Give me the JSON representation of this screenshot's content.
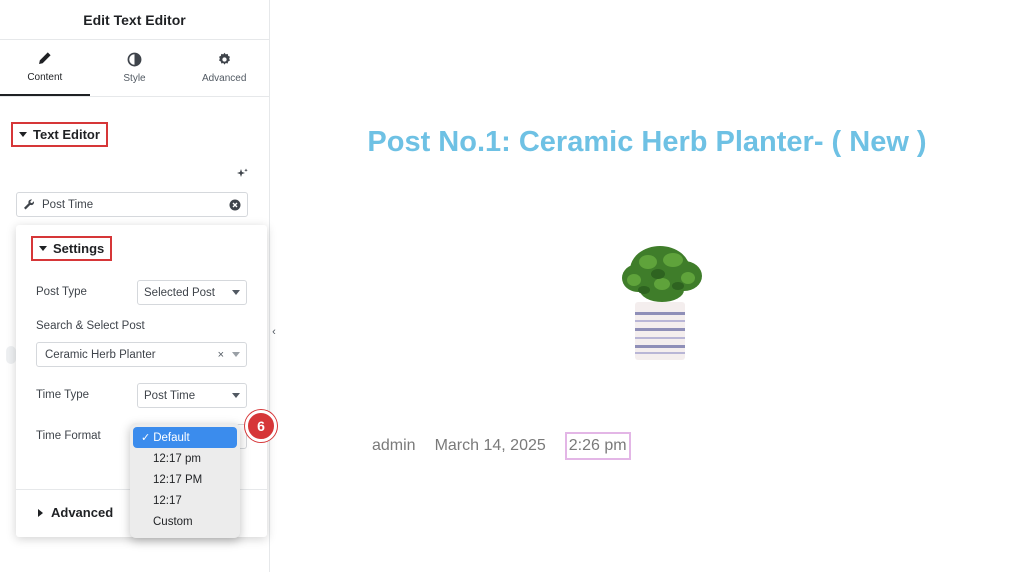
{
  "panel": {
    "title": "Edit Text Editor",
    "tabs": [
      {
        "label": "Content",
        "icon": "pencil-icon",
        "active": true
      },
      {
        "label": "Style",
        "icon": "half-circle-icon",
        "active": false
      },
      {
        "label": "Advanced",
        "icon": "gear-icon",
        "active": false
      }
    ],
    "section_title": "Text Editor",
    "dynamic_tag": {
      "value": "Post Time"
    },
    "settings": {
      "title": "Settings",
      "post_type": {
        "label": "Post Type",
        "value": "Selected Post"
      },
      "search_post": {
        "label": "Search & Select Post",
        "value": "Ceramic Herb Planter",
        "clear": "×"
      },
      "time_type": {
        "label": "Time Type",
        "value": "Post Time"
      },
      "time_format": {
        "label": "Time Format"
      },
      "advanced_title": "Advanced"
    },
    "step_badge": "6",
    "collapse_glyph": "‹"
  },
  "dropdown": {
    "check_glyph": "✓",
    "options": [
      "Default",
      "12:17 pm",
      "12:17 PM",
      "12:17",
      "Custom"
    ],
    "selected": "Default"
  },
  "preview": {
    "title": "Post No.1: Ceramic Herb Planter- ( New )",
    "author": "admin",
    "date": "March 14, 2025",
    "time": "2:26 pm"
  },
  "colors": {
    "accent_red": "#d63638",
    "title_blue": "#6ec1e4",
    "selected_blue": "#3b8ced",
    "time_highlight": "#e3b6e6"
  }
}
